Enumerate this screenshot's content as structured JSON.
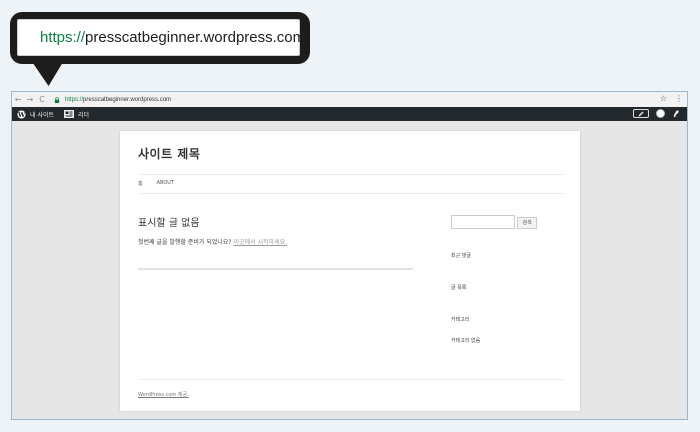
{
  "callout": {
    "scheme": "https://",
    "host": "presscatbeginner.wordpress.com"
  },
  "browser": {
    "nav_back": "←",
    "nav_forward": "→",
    "nav_reload": "C",
    "url_scheme": "https://",
    "url_host": "presscatbeginner.wordpress.com",
    "star": "☆",
    "menu": "⋮"
  },
  "adminbar": {
    "my_site": "내 사이트",
    "reader": "리더"
  },
  "site": {
    "title": "사이트 제목",
    "nav": [
      "홈",
      "ABOUT"
    ],
    "post_title": "표시할 글 없음",
    "post_text": "첫번째 글을 발행할 준비가 되었나요?",
    "post_link": "이곳에서 시작하세요.",
    "search_button": "검색",
    "widgets": [
      "최근 댓글",
      "글 목록",
      "카테고리",
      "카테고리 없음"
    ],
    "footer": "WordPress.com 제공."
  },
  "colors": {
    "adminbar_bg": "#23282d",
    "secure_green": "#0b8043",
    "page_bg": "#eef3f7"
  }
}
